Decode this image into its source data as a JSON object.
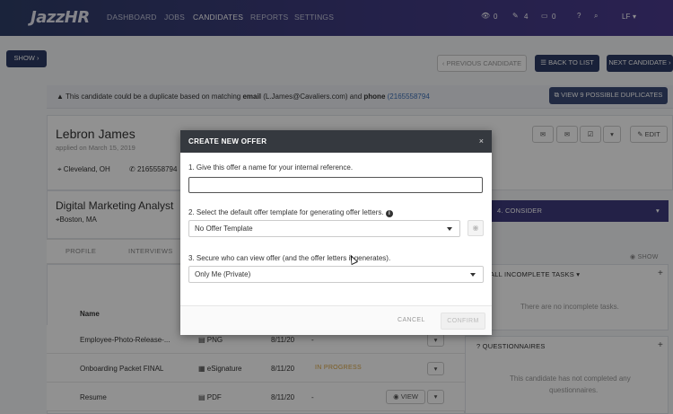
{
  "nav": {
    "logo": "JazzHR",
    "links": [
      "DASHBOARD",
      "JOBS",
      "CANDIDATES",
      "REPORTS",
      "SETTINGS"
    ],
    "counts": {
      "views": "0",
      "starred": "4",
      "messages": "0"
    },
    "user": "LF"
  },
  "toolbar": {
    "show_label": "SHOW",
    "prev_label": "PREVIOUS CANDIDATE",
    "back_label": "BACK TO LIST",
    "next_label": "NEXT CANDIDATE"
  },
  "warning": {
    "prefix": "This candidate could be a duplicate based on matching",
    "email_label": "email",
    "email": "(L.James@Cavaliers.com)",
    "and": "and",
    "phone_label": "phone",
    "phone": "(2165558794",
    "duplicates_label": "VIEW 9 POSSIBLE DUPLICATES"
  },
  "candidate": {
    "name": "Lebron James",
    "applied": "applied on March 15, 2019",
    "location": "Cleveland, OH",
    "phone": "2165558794",
    "edit_label": "EDIT"
  },
  "job": {
    "title": "Digital Marketing Analyst",
    "location": "Boston, MA"
  },
  "tabs": [
    "PROFILE",
    "INTERVIEWS"
  ],
  "files": {
    "header": "Name",
    "rows": [
      {
        "name": "Employee-Photo-Release-...",
        "type": "PNG",
        "date": "8/11/20",
        "status": "-"
      },
      {
        "name": "Onboarding Packet FINAL",
        "type": "eSignature",
        "date": "8/11/20",
        "status": "IN PROGRESS"
      },
      {
        "name": "Resume",
        "type": "PDF",
        "date": "8/11/20",
        "status": "-",
        "action": "VIEW"
      }
    ]
  },
  "right_panel": {
    "stage": "4. CONSIDER",
    "show_label": "SHOW",
    "tasks_title": "ALL INCOMPLETE TASKS",
    "tasks_empty": "There are no incomplete tasks.",
    "questionnaires_title": "QUESTIONNAIRES",
    "questionnaires_empty_1": "This candidate has not completed any",
    "questionnaires_empty_2": "questionnaires."
  },
  "modal": {
    "title": "CREATE NEW OFFER",
    "close": "×",
    "q1": "1. Give this offer a name for your internal reference.",
    "name_value": "",
    "q2": "2. Select the default offer template for generating offer letters.",
    "template_value": "No Offer Template",
    "q3": "3. Secure who can view offer (and the offer letters it generates).",
    "visibility_value": "Only Me (Private)",
    "cancel_label": "CANCEL",
    "confirm_label": "CONFIRM"
  },
  "colors": {
    "nav_start": "#2f3e68",
    "nav_end": "#4a3a8e",
    "primary_button": "#2d3b64",
    "stage_bar": "#3e3a7e",
    "modal_header": "#35393f",
    "link": "#3c6fb6"
  }
}
